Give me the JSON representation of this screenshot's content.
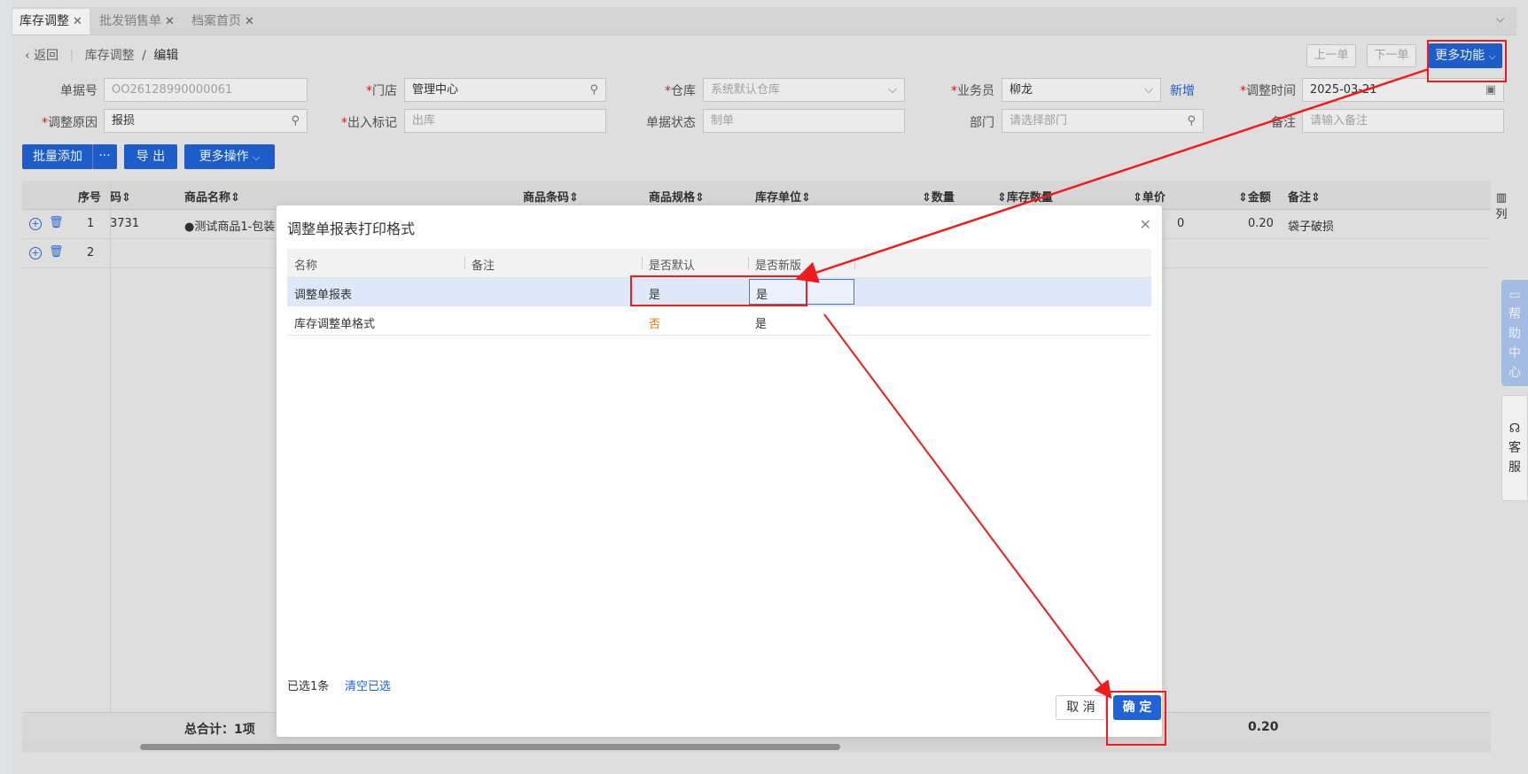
{
  "tabs": [
    {
      "label": "库存调整",
      "close": "✕"
    },
    {
      "label": "批发销售单",
      "close": "✕"
    },
    {
      "label": "档案首页",
      "close": "✕"
    }
  ],
  "nav": {
    "back": "返回",
    "crumb1": "库存调整",
    "sep": "/",
    "crumb2": "编辑"
  },
  "toolbar": {
    "prev": "上一单",
    "next": "下一单",
    "more_func": "更多功能"
  },
  "form": {
    "order_no_label": "单据号",
    "order_no": "OO26128990000061",
    "store_label": "门店",
    "store": "管理中心",
    "warehouse_label": "仓库",
    "warehouse_placeholder": "系统默认仓库",
    "salesman_label": "业务员",
    "salesman": "柳龙",
    "add_new": "新增",
    "adjust_time_label": "调整时间",
    "adjust_time": "2025-03-21",
    "reason_label": "调整原因",
    "reason": "报损",
    "io_label": "出入标记",
    "io_placeholder": "出库",
    "status_label": "单据状态",
    "status_placeholder": "制单",
    "dept_label": "部门",
    "dept_placeholder": "请选择部门",
    "remark_label": "备注",
    "remark_placeholder": "请输入备注"
  },
  "actions": {
    "batch_add": "批量添加",
    "more_dots": "···",
    "export": "导 出",
    "more_ops": "更多操作"
  },
  "grid": {
    "headers": [
      "序号",
      "码",
      "商品名称",
      "商品条码",
      "商品规格",
      "库存单位",
      "数量",
      "库存数量",
      "单价",
      "金额",
      "备注"
    ],
    "col_setting": "列",
    "rows": [
      {
        "seq": "1",
        "code": "3731",
        "name": "●测试商品1-包装",
        "amount": "0.20",
        "remark": "袋子破损",
        "price_tail": "0"
      },
      {
        "seq": "2"
      }
    ],
    "total_label": "总合计：1项",
    "total_amount": "0.20"
  },
  "modal": {
    "title": "调整单报表打印格式",
    "close": "✕",
    "headers": [
      "名称",
      "备注",
      "是否默认",
      "是否新版"
    ],
    "rows": [
      {
        "name": "调整单报表",
        "remark": "",
        "is_default": "是",
        "is_new": "是"
      },
      {
        "name": "库存调整单格式",
        "remark": "",
        "is_default": "否",
        "is_new": "是"
      }
    ],
    "selected_count": "已选1条",
    "clear_selected": "清空已选",
    "cancel": "取 消",
    "confirm": "确 定"
  },
  "side": {
    "help": "帮助中心",
    "service": "客服"
  },
  "colors": {
    "primary": "#1f63d6",
    "annotation": "#f01c1c",
    "selected_row": "#dde8fb",
    "orange": "#e07a1a"
  }
}
